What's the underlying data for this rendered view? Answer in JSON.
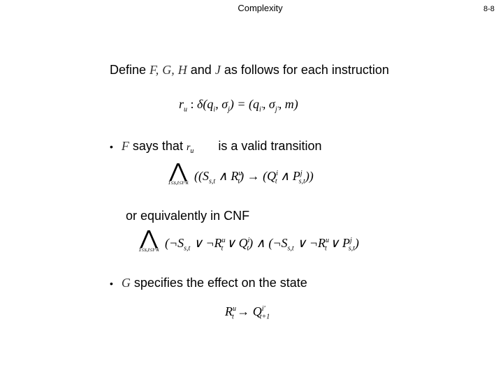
{
  "header": {
    "title": "Complexity",
    "page_number": "8-8"
  },
  "intro": {
    "prefix": "Define ",
    "vars": [
      "F,",
      "G,",
      "H"
    ],
    "and": " and ",
    "var_j": "J",
    "suffix": " as follows for each instruction"
  },
  "instruction_formula": {
    "lhs": "r",
    "lhs_sub": "u",
    "colon": " :  ",
    "delta": "δ(q",
    "q_sub": "i",
    "comma_sigma": ", σ",
    "sigma_sub": "j",
    "eq_open": ") = (q",
    "q2_sub": "i'",
    "comma_sigma2": ", σ",
    "sigma2_sub": "j'",
    "tail": ", m)"
  },
  "bullet_f": {
    "bullet": "•",
    "var": "F",
    "text_a": " says that ",
    "r": "r",
    "r_sub": "u",
    "text_b": " is a valid transition"
  },
  "formula_f": {
    "wedge": "⋀",
    "limits": "1≤s,t≤t^k",
    "body": "((S",
    "s_sub": "s,t",
    "and1": " ∧ R",
    "r_sup": "u",
    "r_sub": "t",
    "arrow": ") → (Q",
    "q_sup": "i",
    "q_sub": "t",
    "and2": " ∧ P",
    "p_sup": "j",
    "p_sub": "s,t",
    "close": "))"
  },
  "cnf_label": "or equivalently in CNF",
  "formula_cnf": {
    "wedge": "⋀",
    "limits": "1≤s,t≤t^k",
    "p1_open": "(¬S",
    "p1_s_sub": "s,t",
    "p1_or1": " ∨ ¬R",
    "p1_r_sup": "u",
    "p1_r_sub": "t",
    "p1_or2": " ∨ Q",
    "p1_q_sup": "i",
    "p1_q_sub": "t",
    "p1_close": ") ∧ (¬S",
    "p2_s_sub": "s,t",
    "p2_or1": " ∨ ¬R",
    "p2_r_sup": "u",
    "p2_r_sub": "t",
    "p2_or2": " ∨ P",
    "p2_p_sup": "j",
    "p2_p_sub": "s,t",
    "p2_close": ")"
  },
  "bullet_g": {
    "bullet": "•",
    "var": "G",
    "text": " specifies the effect on the state"
  },
  "formula_g": {
    "r": "R",
    "r_sup": "u",
    "r_sub": "t",
    "arrow": " → Q",
    "q_sup": "i'",
    "q_sub": "t+1"
  }
}
